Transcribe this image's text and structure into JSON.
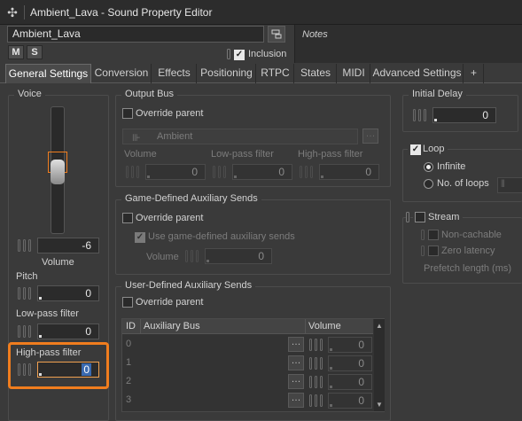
{
  "window": {
    "title": "Ambient_Lava - Sound Property Editor",
    "logo_icon": "wwise-logo-icon"
  },
  "object": {
    "name": "Ambient_Lava",
    "mute_label": "M",
    "solo_label": "S",
    "inclusion_label": "Inclusion",
    "inclusion_checked": true
  },
  "notes": {
    "placeholder": "Notes"
  },
  "tabs": [
    {
      "label": "General Settings",
      "active": true
    },
    {
      "label": "Conversion"
    },
    {
      "label": "Effects"
    },
    {
      "label": "Positioning"
    },
    {
      "label": "RTPC"
    },
    {
      "label": "States"
    },
    {
      "label": "MIDI"
    },
    {
      "label": "Advanced Settings"
    },
    {
      "label": "+"
    }
  ],
  "voice": {
    "title": "Voice",
    "volume_value": "-6",
    "volume_label": "Volume",
    "pitch_label": "Pitch",
    "pitch_value": "0",
    "lowpass_label": "Low-pass filter",
    "lowpass_value": "0",
    "highpass_label": "High-pass filter",
    "highpass_value": "0"
  },
  "output_bus": {
    "title": "Output Bus",
    "override_label": "Override parent",
    "bus_name": "Ambient",
    "volume_label": "Volume",
    "volume_value": "0",
    "lowpass_label": "Low-pass filter",
    "lowpass_value": "0",
    "highpass_label": "High-pass filter",
    "highpass_value": "0"
  },
  "game_aux": {
    "title": "Game-Defined Auxiliary Sends",
    "override_label": "Override parent",
    "use_label": "Use game-defined auxiliary sends",
    "volume_label": "Volume",
    "volume_value": "0"
  },
  "user_aux": {
    "title": "User-Defined Auxiliary Sends",
    "override_label": "Override parent",
    "headers": {
      "id": "ID",
      "bus": "Auxiliary Bus",
      "volume": "Volume"
    },
    "rows": [
      {
        "id": "0",
        "volume": "0"
      },
      {
        "id": "1",
        "volume": "0"
      },
      {
        "id": "2",
        "volume": "0"
      },
      {
        "id": "3",
        "volume": "0"
      }
    ]
  },
  "initial_delay": {
    "title": "Initial Delay",
    "value": "0"
  },
  "loop": {
    "label": "Loop",
    "infinite_label": "Infinite",
    "nloops_label": "No. of loops"
  },
  "stream": {
    "label": "Stream",
    "noncachable_label": "Non-cachable",
    "zerolatency_label": "Zero latency",
    "prefetch_label": "Prefetch length (ms)"
  },
  "colors": {
    "highlight": "#f07d1e",
    "background": "#3a3a3a"
  }
}
